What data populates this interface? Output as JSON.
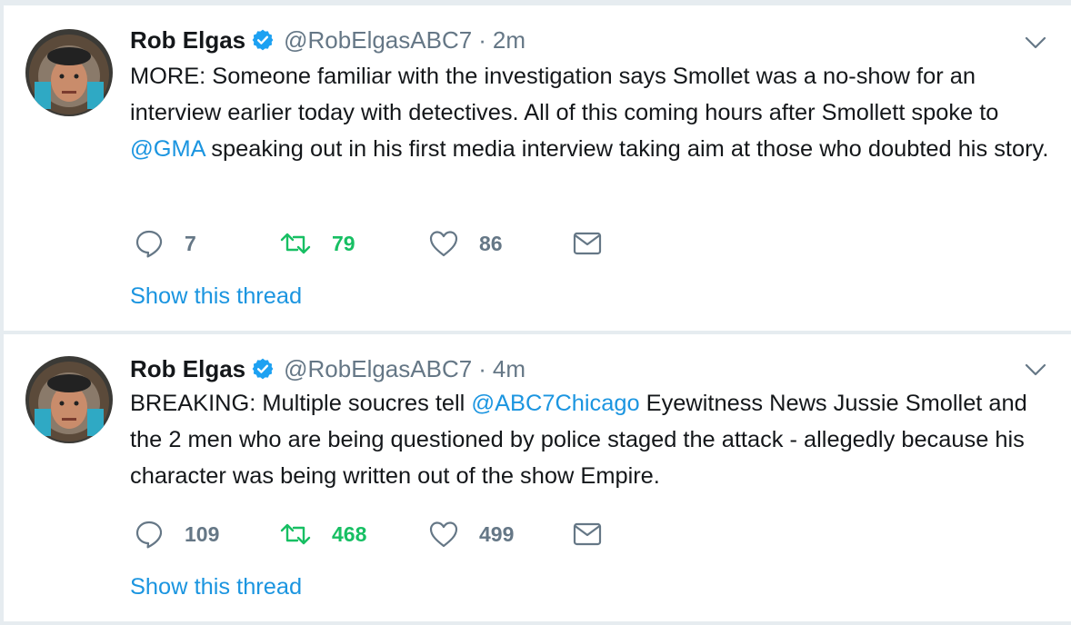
{
  "tweets": [
    {
      "author": {
        "name": "Rob Elgas",
        "handle": "@RobElgasABC7",
        "verified": true,
        "avatar": "avatar-photo"
      },
      "time_sep": "·",
      "time": "2m",
      "text": {
        "p1": "MORE: Someone familiar with the investigation says Smollet was a no-show for an interview earlier today  with detectives. All of this coming hours after Smollett spoke to ",
        "mention": "@GMA",
        "p2": " speaking out in his first media interview taking aim at those who doubted his story."
      },
      "counts": {
        "replies": "7",
        "retweets": "79",
        "likes": "86"
      },
      "show_thread": "Show this thread"
    },
    {
      "author": {
        "name": "Rob Elgas",
        "handle": "@RobElgasABC7",
        "verified": true,
        "avatar": "avatar-photo"
      },
      "time_sep": "·",
      "time": "4m",
      "text": {
        "p1": "BREAKING: Multiple soucres tell ",
        "mention": "@ABC7Chicago",
        "p2": " Eyewitness News Jussie Smollet and the 2 men who are being questioned by police staged the attack - allegedly because his character was being written out of the show Empire."
      },
      "counts": {
        "replies": "109",
        "retweets": "468",
        "likes": "499"
      },
      "show_thread": "Show this thread"
    }
  ],
  "icons": {
    "reply": "reply-icon",
    "retweet": "retweet-icon",
    "like": "heart-icon",
    "dm": "envelope-icon",
    "caret": "chevron-down-icon",
    "verified": "verified-badge-icon"
  },
  "colors": {
    "text": "#14171a",
    "secondary": "#657786",
    "link": "#1b95e0",
    "retweet": "#17bf63",
    "verified": "#1da1f2",
    "divider": "#e6ecf0"
  }
}
